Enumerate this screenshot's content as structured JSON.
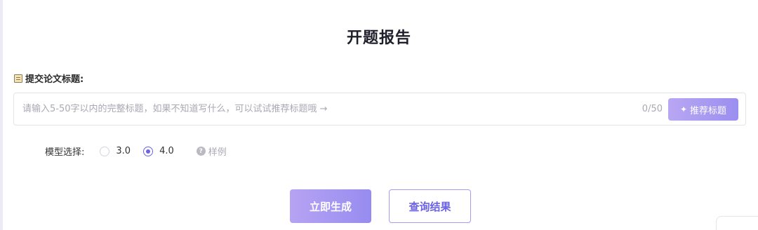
{
  "page": {
    "title": "开题报告"
  },
  "title_section": {
    "label": "提交论文标题:",
    "label_icon": "notepad-icon",
    "input_value": "",
    "placeholder": "请输入5-50字以内的完整标题，如果不知道写什么，可以试试推荐标题哦 →",
    "char_count": "0/50",
    "recommend_button": {
      "label": "推荐标题",
      "icon": "sparkle-icon"
    }
  },
  "model": {
    "label": "模型选择:",
    "options": [
      {
        "label": "3.0",
        "checked": false
      },
      {
        "label": "4.0",
        "checked": true
      }
    ],
    "sample_link": {
      "label": "样例",
      "icon": "question-icon"
    }
  },
  "actions": {
    "generate_label": "立即生成",
    "query_label": "查询结果"
  },
  "colors": {
    "accent": "#6c63e6",
    "button_gradient_start": "#b7a3f3",
    "button_gradient_end": "#968cf0"
  }
}
